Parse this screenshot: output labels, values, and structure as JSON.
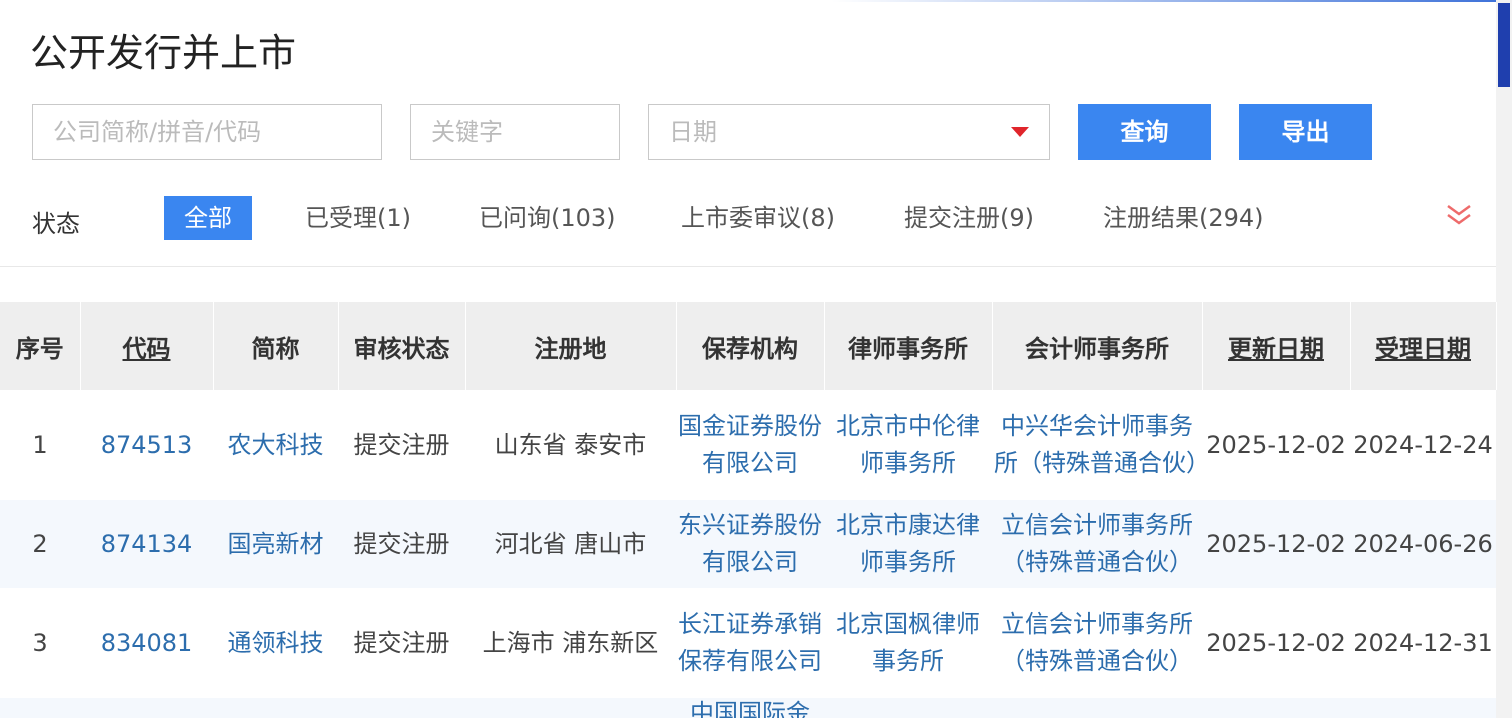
{
  "page": {
    "title": "公开发行并上市"
  },
  "search": {
    "company_placeholder": "公司简称/拼音/代码",
    "keyword_placeholder": "关键字",
    "date_placeholder": "日期",
    "query_label": "查询",
    "export_label": "导出"
  },
  "filters": {
    "label": "状态",
    "items": [
      "全部",
      "已受理(1)",
      "已问询(103)",
      "上市委审议(8)",
      "提交注册(9)",
      "注册结果(294)"
    ],
    "active": "全部"
  },
  "table": {
    "columns": [
      "序号",
      "代码",
      "简称",
      "审核状态",
      "注册地",
      "保荐机构",
      "律师事务所",
      "会计师事务所",
      "更新日期",
      "受理日期"
    ],
    "rows": [
      [
        "1",
        "874513",
        "农大科技",
        "提交注册",
        "山东省 泰安市",
        "国金证券股份有限公司",
        "北京市中伦律师事务所",
        "中兴华会计师事务所（特殊普通合伙）",
        "2025-12-02",
        "2024-12-24"
      ],
      [
        "2",
        "874134",
        "国亮新材",
        "提交注册",
        "河北省 唐山市",
        "东兴证券股份有限公司",
        "北京市康达律师事务所",
        "立信会计师事务所（特殊普通合伙）",
        "2025-12-02",
        "2024-06-26"
      ],
      [
        "3",
        "834081",
        "通领科技",
        "提交注册",
        "上海市 浦东新区",
        "长江证券承销保荐有限公司",
        "北京国枫律师事务所",
        "立信会计师事务所（特殊普通合伙）",
        "2025-12-02",
        "2024-12-31"
      ],
      [
        "",
        "",
        "",
        "",
        "",
        "中国国际金",
        "",
        "",
        "",
        ""
      ]
    ]
  },
  "colors": {
    "accent": "#3a86f0",
    "link": "#2c6dad",
    "caret": "#e0252b"
  }
}
